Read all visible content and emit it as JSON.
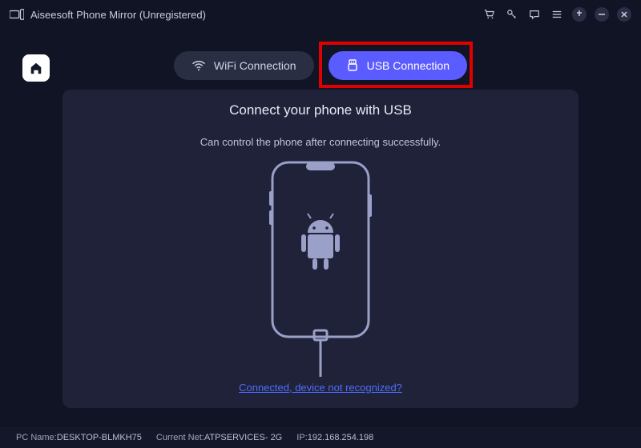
{
  "titlebar": {
    "app_name": "Aiseesoft Phone Mirror",
    "registration_suffix": " (Unregistered)"
  },
  "tabs": {
    "wifi_label": "WiFi Connection",
    "usb_label": "USB Connection"
  },
  "panel": {
    "title": "Connect your phone with USB",
    "subtitle": "Can control the phone after connecting successfully.",
    "help_link": "Connected, device not recognized?"
  },
  "statusbar": {
    "pc_label": "PC Name:",
    "pc_value": "DESKTOP-BLMKH75",
    "net_label": "Current Net:",
    "net_value": "ATPSERVICES- 2G",
    "ip_label": "IP:",
    "ip_value": "192.168.254.198"
  },
  "colors": {
    "accent": "#5b5cff",
    "highlight": "#e00000",
    "link": "#4f6dff"
  }
}
